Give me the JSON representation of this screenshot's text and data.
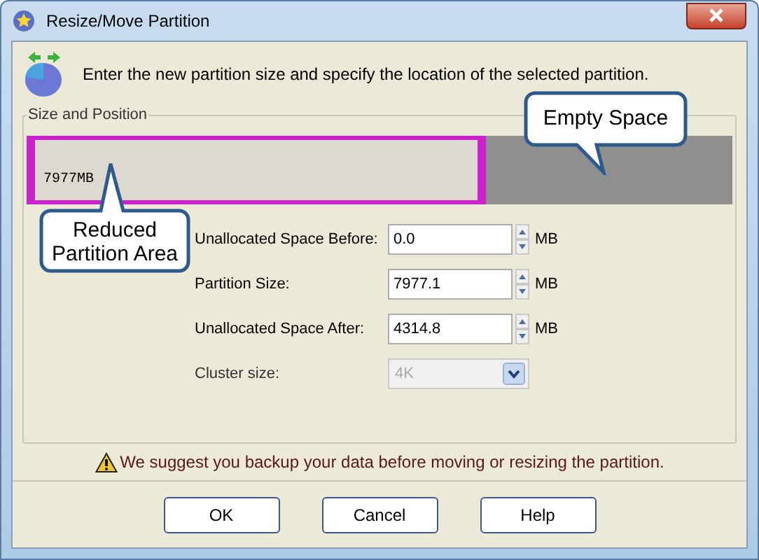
{
  "window": {
    "title": "Resize/Move Partition"
  },
  "header": {
    "text": "Enter the new partition size and specify the location of the selected partition."
  },
  "group": {
    "title": "Size and Position"
  },
  "partition_bar": {
    "label": "7977MB",
    "level": 0.65
  },
  "callouts": [
    {
      "kind": "above",
      "text": "Empty Space"
    },
    {
      "kind": "below",
      "text": "Reduced Partition Area"
    }
  ],
  "fields": [
    {
      "kind": "spin",
      "label": "Unallocated Space Before:",
      "value": "0.0",
      "unit": "MB",
      "disabled": false
    },
    {
      "kind": "spin",
      "label": "Partition Size:",
      "value": "7977.1",
      "unit": "MB",
      "disabled": false
    },
    {
      "kind": "spin",
      "label": "Unallocated Space After:",
      "value": "4314.8",
      "unit": "MB",
      "disabled": false
    },
    {
      "kind": "dropdown",
      "label": "Cluster size:",
      "value": "4K",
      "disabled": true
    }
  ],
  "warning": "We suggest you backup your data before moving or resizing the partition.",
  "buttons": [
    "OK",
    "Cancel",
    "Help"
  ]
}
